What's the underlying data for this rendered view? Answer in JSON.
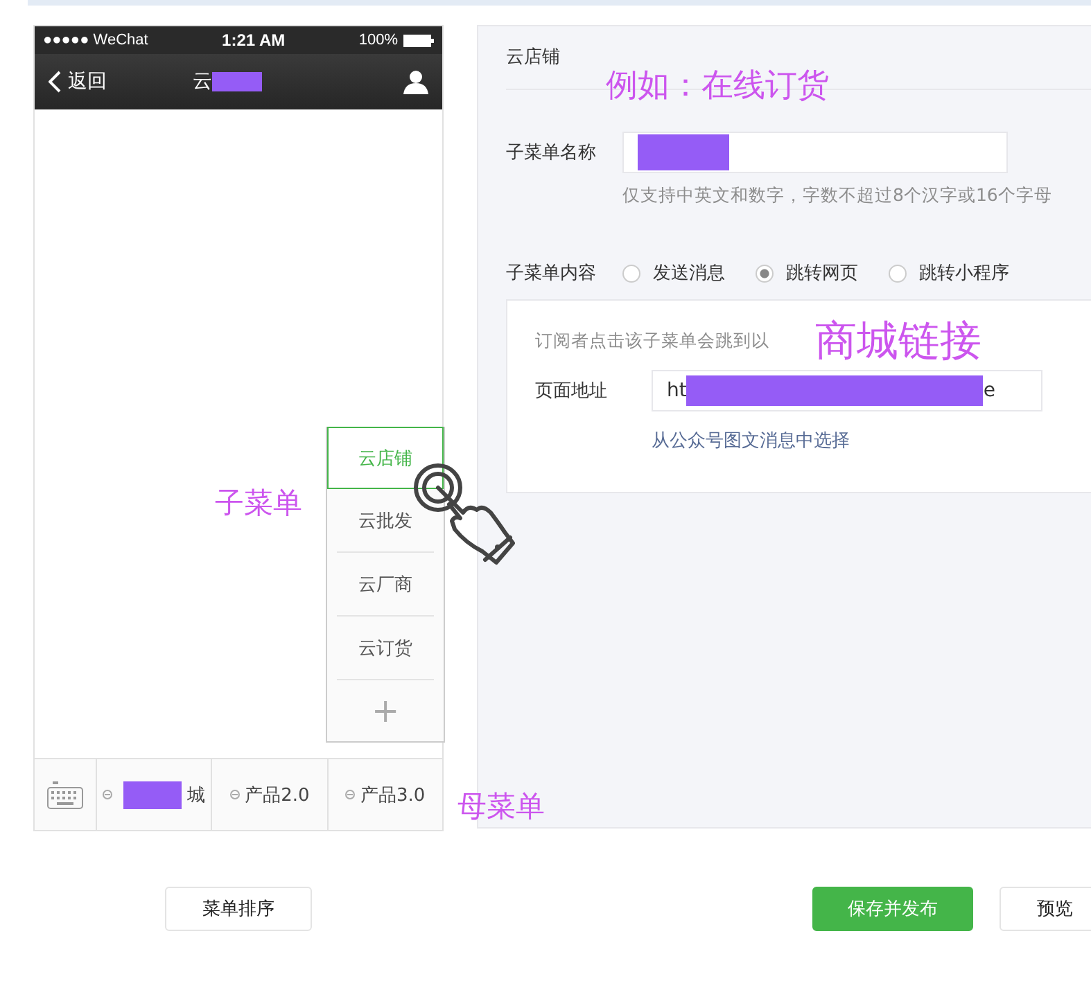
{
  "phone": {
    "status": {
      "carrier": "●●●●● WeChat",
      "time": "1:21 AM",
      "battery": "100%"
    },
    "nav": {
      "back": "返回",
      "title": "云"
    },
    "submenu": {
      "items": [
        {
          "label": "云店铺",
          "selected": true
        },
        {
          "label": "云批发",
          "selected": false
        },
        {
          "label": "云厂商",
          "selected": false
        },
        {
          "label": "云订货",
          "selected": false
        }
      ],
      "add": "+"
    },
    "menu_bar": [
      {
        "label": "城",
        "redacted": true
      },
      {
        "label": "产品2.0",
        "redacted": false
      },
      {
        "label": "产品3.0",
        "redacted": false
      }
    ]
  },
  "editor": {
    "title": "云店铺",
    "name_label": "子菜单名称",
    "name_hint": "仅支持中英文和数字，字数不超过8个汉字或16个字母",
    "content_label": "子菜单内容",
    "options": [
      {
        "label": "发送消息",
        "selected": false
      },
      {
        "label": "跳转网页",
        "selected": true
      },
      {
        "label": "跳转小程序",
        "selected": false
      }
    ],
    "link_box": {
      "hint": "订阅者点击该子菜单会跳到以",
      "url_label": "页面地址",
      "url_start": "ht",
      "url_end": "e",
      "pick_link": "从公众号图文消息中选择"
    }
  },
  "annotations": [
    {
      "text": "例如：在线订货"
    },
    {
      "text": "商城链接"
    },
    {
      "text": "子菜单"
    },
    {
      "text": "母菜单"
    }
  ],
  "buttons": [
    {
      "label": "菜单排序",
      "kind": "default"
    },
    {
      "label": "保存并发布",
      "kind": "primary"
    },
    {
      "label": "预览",
      "kind": "default"
    }
  ]
}
